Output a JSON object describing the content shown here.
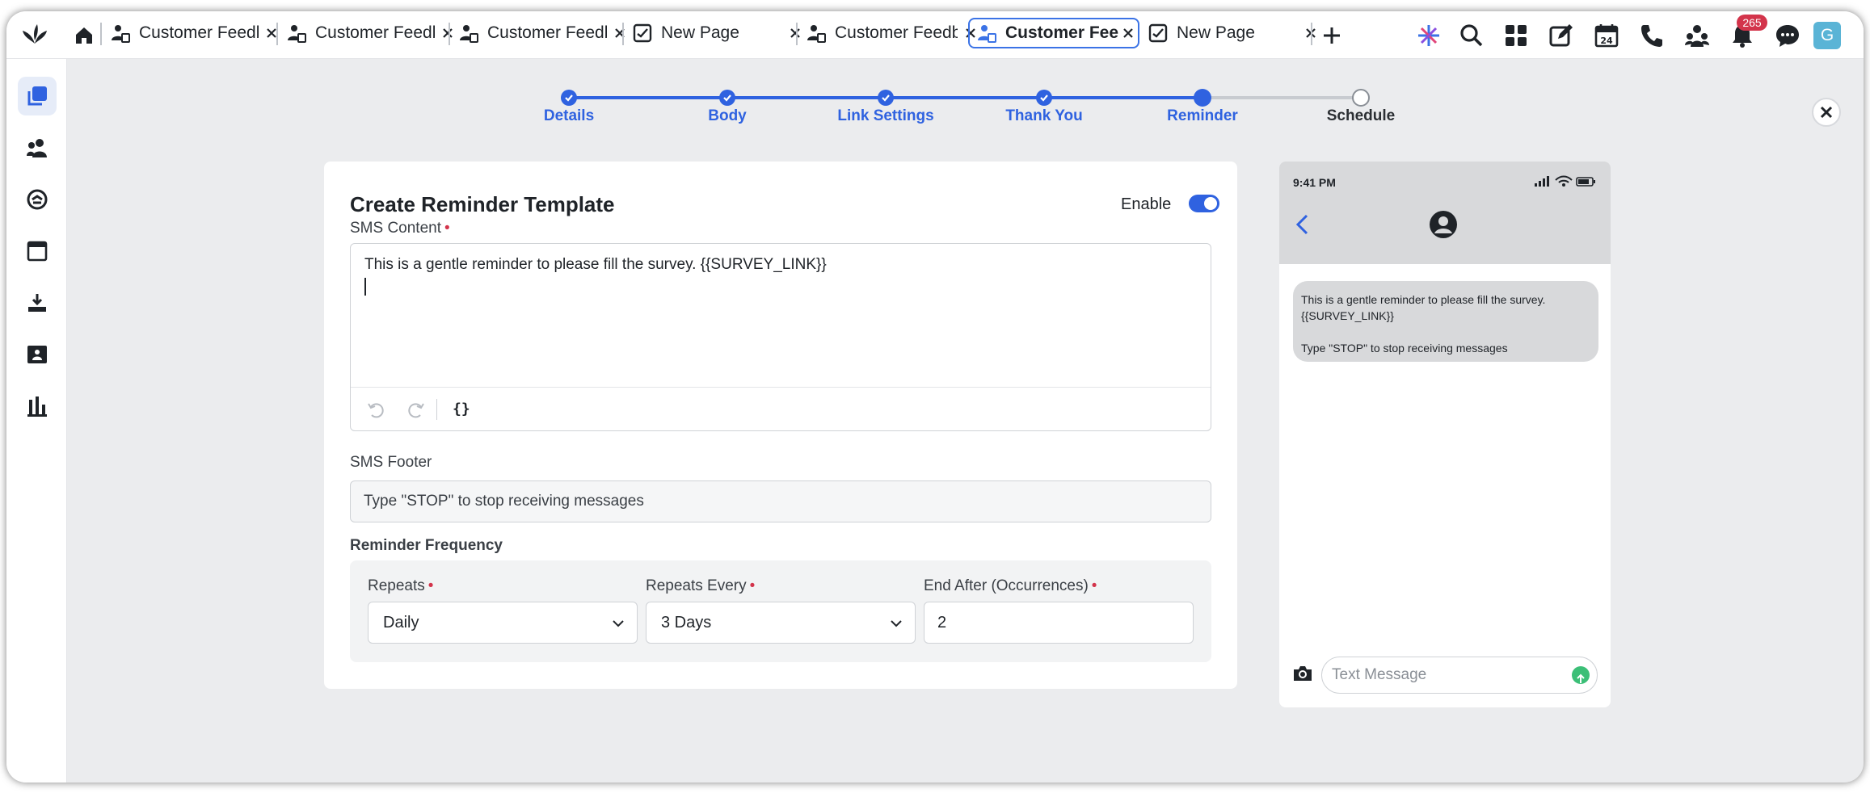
{
  "browser": {
    "tabs": [
      {
        "label": "Customer Feedback",
        "icon": "survey-icon",
        "active": false
      },
      {
        "label": "Customer Feedback",
        "icon": "survey-icon",
        "active": false
      },
      {
        "label": "Customer Feedback",
        "icon": "survey-icon",
        "active": false
      },
      {
        "label": "New Page",
        "icon": "page-icon",
        "active": false
      },
      {
        "label": "Customer Feedback",
        "icon": "survey-icon",
        "active": false
      },
      {
        "label": "Customer Feed",
        "icon": "survey-icon",
        "active": true
      },
      {
        "label": "New Page",
        "icon": "page-icon",
        "active": false
      }
    ],
    "notification_count": "265",
    "avatar_initial": "G"
  },
  "sidebar": {
    "items": [
      "surveys-icon",
      "audience-icon",
      "loop-icon",
      "calendar-window-icon",
      "download-icon",
      "presentation-icon",
      "reports-icon"
    ]
  },
  "stepper": {
    "steps": [
      {
        "label": "Details",
        "state": "done"
      },
      {
        "label": "Body",
        "state": "done"
      },
      {
        "label": "Link Settings",
        "state": "done"
      },
      {
        "label": "Thank You",
        "state": "done"
      },
      {
        "label": "Reminder",
        "state": "current"
      },
      {
        "label": "Schedule",
        "state": "todo"
      }
    ]
  },
  "form": {
    "title": "Create Reminder Template",
    "enable_label": "Enable",
    "enabled": true,
    "sms_content_label": "SMS Content",
    "sms_content_value": "This is a gentle reminder to please fill the survey. {{SURVEY_LINK}}",
    "variable_button": "{}",
    "sms_footer_label": "SMS Footer",
    "sms_footer_value": "Type \"STOP\" to stop receiving messages",
    "frequency_title": "Reminder Frequency",
    "repeats_label": "Repeats",
    "repeats_value": "Daily",
    "repeats_every_label": "Repeats Every",
    "repeats_every_value": "3 Days",
    "end_after_label": "End After (Occurrences)",
    "end_after_value": "2",
    "required_mark": "•"
  },
  "preview": {
    "time": "9:41 PM",
    "message_line1": "This is a gentle reminder to please fill the survey.",
    "message_line2": "{{SURVEY_LINK}}",
    "message_footer": "Type \"STOP\" to stop receiving messages",
    "input_placeholder": "Text Message"
  },
  "colors": {
    "accent": "#2f62e0",
    "required": "#d3344b",
    "badge": "#d3344b",
    "send": "#3cbf77"
  }
}
